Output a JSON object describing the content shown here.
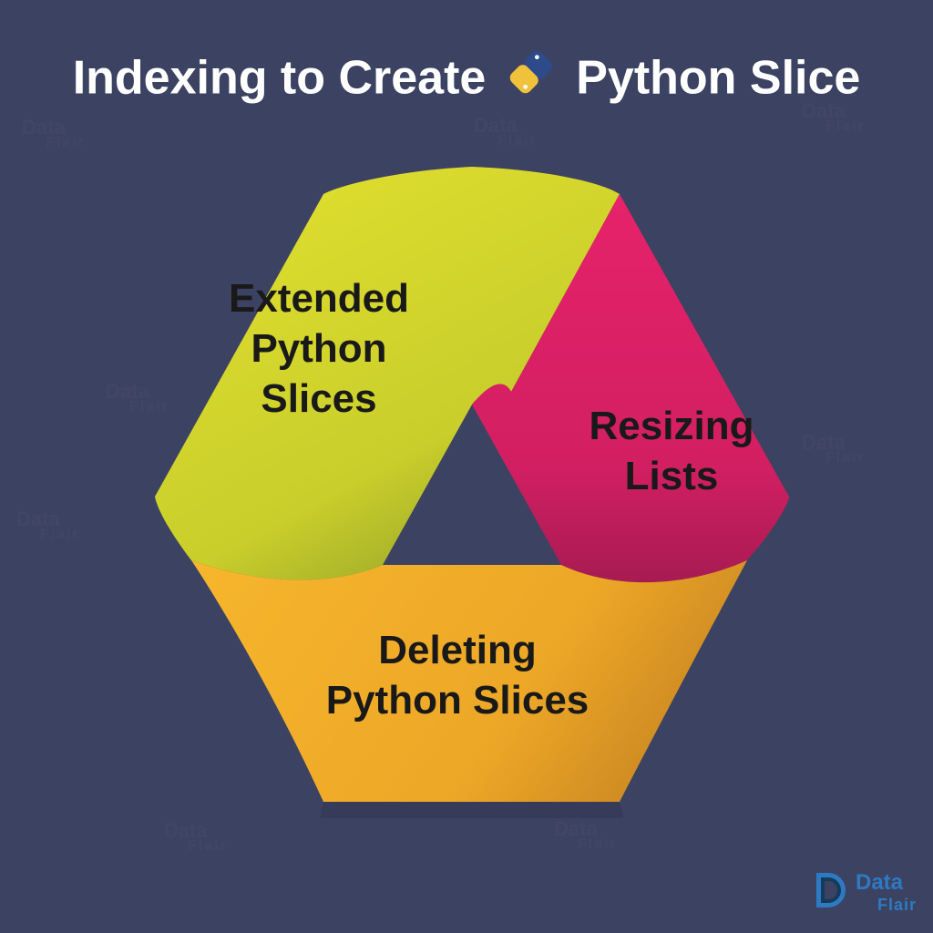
{
  "title_left": "Indexing to Create",
  "title_right": "Python Slice",
  "segments": {
    "top_left": "Extended\nPython\nSlices",
    "right": "Resizing\nLists",
    "bottom": "Deleting\nPython Slices"
  },
  "brand": {
    "name1": "Data",
    "name2": "Flair"
  },
  "colors": {
    "bg": "#3c4262",
    "yellowgreen_light": "#e3e12f",
    "yellowgreen_mid": "#c9ce2b",
    "yellowgreen_dark": "#7a8f2a",
    "magenta_light": "#e6226a",
    "magenta_mid": "#c91e5e",
    "magenta_dark": "#751242",
    "orange_light": "#f6b62d",
    "orange_mid": "#e6a125",
    "orange_dark": "#8a5e1a",
    "text_dark": "#191919"
  }
}
